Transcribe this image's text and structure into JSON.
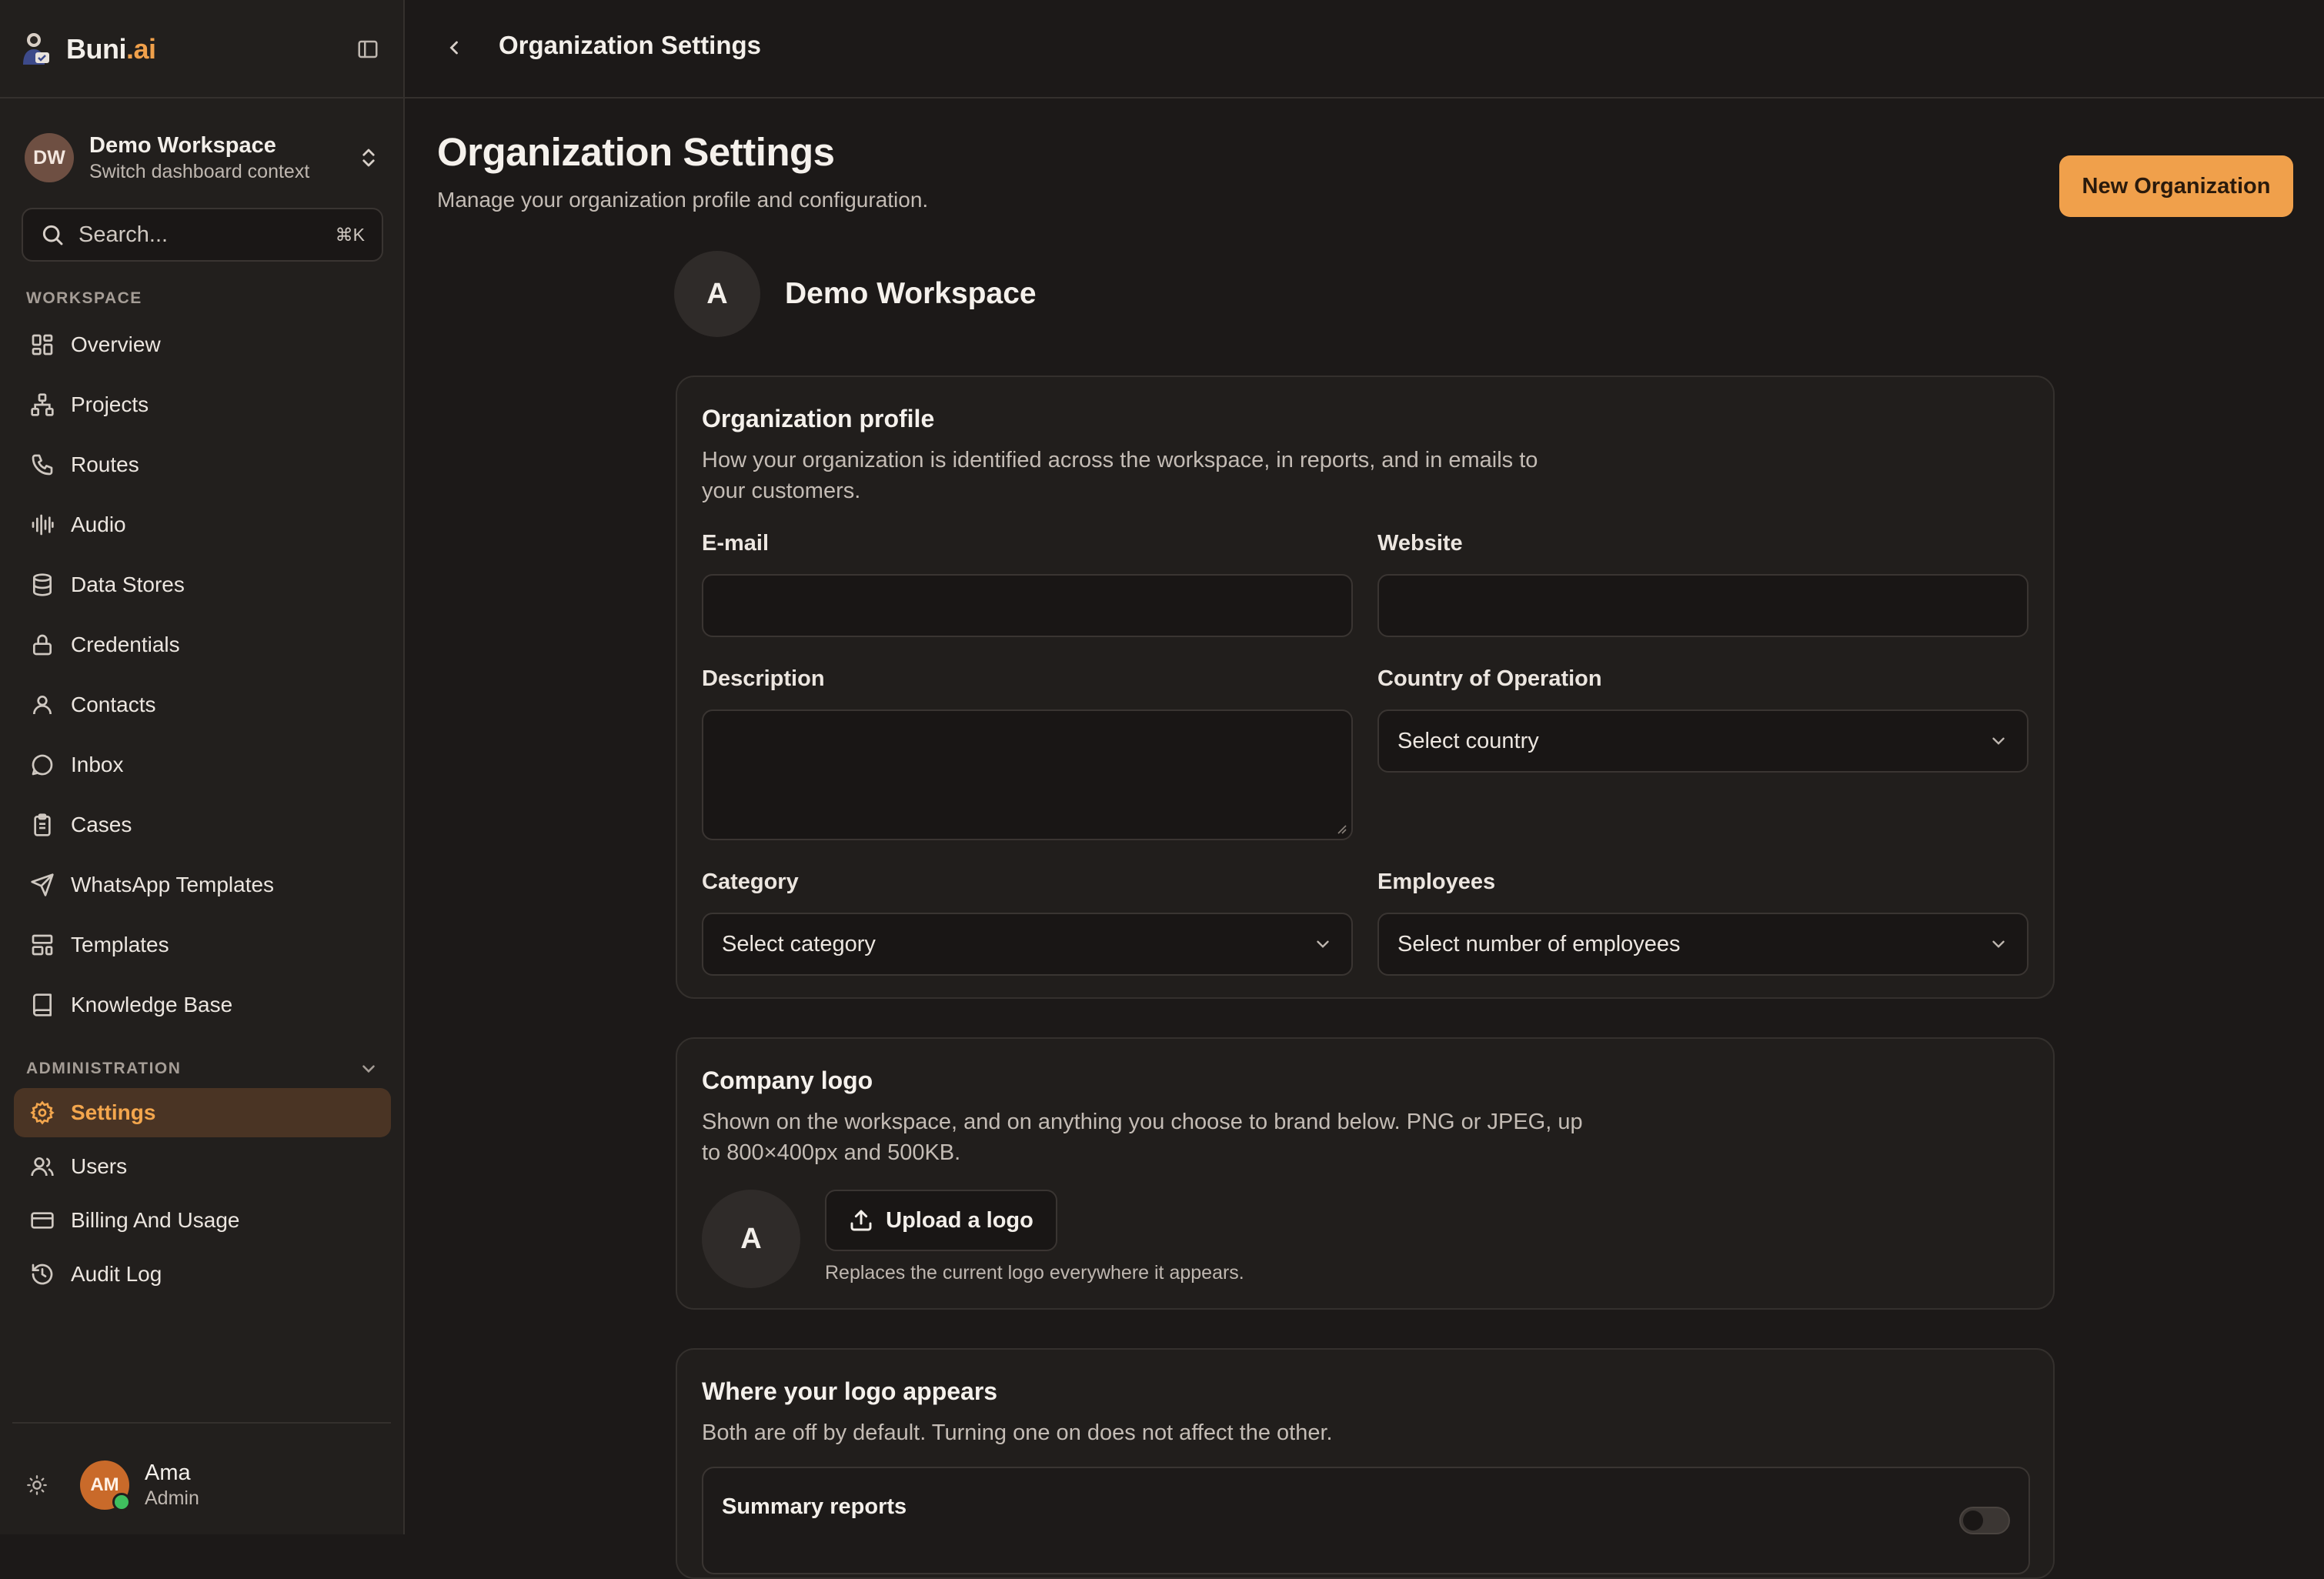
{
  "brand": {
    "name": "Buni",
    "suffix": ".ai"
  },
  "workspace_switcher": {
    "initials": "DW",
    "name": "Demo Workspace",
    "subtitle": "Switch dashboard context"
  },
  "search": {
    "placeholder": "Search...",
    "shortcut": "⌘K"
  },
  "sidebar": {
    "workspace_label": "WORKSPACE",
    "workspace_items": [
      {
        "label": "Overview",
        "icon": "grid-icon"
      },
      {
        "label": "Projects",
        "icon": "projects-icon"
      },
      {
        "label": "Routes",
        "icon": "phone-icon"
      },
      {
        "label": "Audio",
        "icon": "audio-waveform-icon"
      },
      {
        "label": "Data Stores",
        "icon": "database-icon"
      },
      {
        "label": "Credentials",
        "icon": "lock-icon"
      },
      {
        "label": "Contacts",
        "icon": "user-icon"
      },
      {
        "label": "Inbox",
        "icon": "message-circle-icon"
      },
      {
        "label": "Cases",
        "icon": "clipboard-icon"
      },
      {
        "label": "WhatsApp Templates",
        "icon": "send-icon"
      },
      {
        "label": "Templates",
        "icon": "layout-template-icon"
      },
      {
        "label": "Knowledge Base",
        "icon": "book-icon"
      }
    ],
    "admin_label": "ADMINISTRATION",
    "admin_items": [
      {
        "label": "Settings",
        "icon": "gear-icon",
        "active": true
      },
      {
        "label": "Users",
        "icon": "users-icon"
      },
      {
        "label": "Billing And Usage",
        "icon": "credit-card-icon"
      },
      {
        "label": "Audit Log",
        "icon": "history-icon"
      }
    ]
  },
  "user": {
    "initials": "AM",
    "name": "Ama",
    "role": "Admin"
  },
  "topbar": {
    "title": "Organization Settings"
  },
  "page": {
    "title": "Organization Settings",
    "subtitle": "Manage your organization profile and configuration.",
    "new_button": "New Organization"
  },
  "org": {
    "initial": "A",
    "name": "Demo Workspace"
  },
  "profile_card": {
    "title": "Organization profile",
    "description": "How your organization is identified across the workspace, in reports, and in emails to your customers.",
    "email_label": "E-mail",
    "email_value": "",
    "website_label": "Website",
    "website_value": "",
    "description_label": "Description",
    "description_value": "",
    "country_label": "Country of Operation",
    "country_value": "Select country",
    "category_label": "Category",
    "category_value": "Select category",
    "employees_label": "Employees",
    "employees_value": "Select number of employees"
  },
  "logo_card": {
    "title": "Company logo",
    "description": "Shown on the workspace, and on anything you choose to brand below. PNG or JPEG, up to 800×400px and 500KB.",
    "avatar_initial": "A",
    "upload_label": "Upload a logo",
    "hint": "Replaces the current logo everywhere it appears."
  },
  "placement_card": {
    "title": "Where your logo appears",
    "description": "Both are off by default. Turning one on does not affect the other.",
    "summary_reports_label": "Summary reports",
    "summary_reports_enabled": false
  },
  "colors": {
    "accent": "#f0a04b",
    "background": "#1c1918",
    "sidebar": "#221f1d",
    "active_bg": "#4a3424"
  }
}
